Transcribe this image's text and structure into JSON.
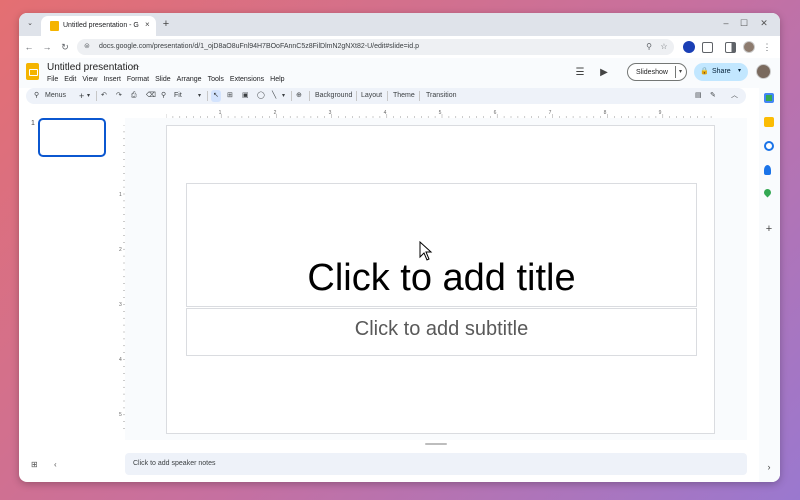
{
  "browser": {
    "tab_title": "Untitled presentation - Google",
    "tab_close": "×",
    "new_tab": "+",
    "tab_list": "⌄",
    "window_minimize": "–",
    "window_maximize": "☐",
    "window_close": "✕",
    "back": "←",
    "forward": "→",
    "reload": "↻",
    "url": "docs.google.com/presentation/d/1_ojD8aO8uFnl94H7BOoFAnnC5z8FilDlmN2gNXt82-U/edit#slide=id.p",
    "site_info": "⊜",
    "zoom_icon": "⚲",
    "bookmark_star": "☆",
    "menu_dots": "⋮"
  },
  "app": {
    "title": "Untitled presentation",
    "star": "☆",
    "menus": [
      "File",
      "Edit",
      "View",
      "Insert",
      "Format",
      "Slide",
      "Arrange",
      "Tools",
      "Extensions",
      "Help"
    ],
    "comments_icon": "☰",
    "meet_icon": "▶",
    "slideshow_label": "Slideshow",
    "slideshow_dropdown": "▾",
    "share_label": "Share",
    "share_lock": "🔒",
    "share_dropdown": "▾"
  },
  "toolbar": {
    "menus_search": "Menus",
    "new_slide": "+",
    "new_slide_dd": "▾",
    "undo": "↶",
    "redo": "↷",
    "print": "⎙",
    "paint_format": "⌫",
    "zoom_icon": "⚲",
    "zoom_value": "Fit",
    "zoom_dd": "▾",
    "select_tool": "↖",
    "textbox_tool": "⊞",
    "image_tool": "▣",
    "shape_tool": "◯",
    "line_tool": "╲",
    "line_dd": "▾",
    "comment_tool": "⊕",
    "background": "Background",
    "layout": "Layout",
    "theme": "Theme",
    "transition": "Transition",
    "chart_icon": "▤",
    "pen_icon": "✎",
    "collapse": "︿"
  },
  "filmstrip": {
    "slide_number": "1"
  },
  "slide": {
    "title_placeholder": "Click to add title",
    "subtitle_placeholder": "Click to add subtitle"
  },
  "ruler": {
    "h_labels": [
      "1",
      "2",
      "3",
      "4",
      "5",
      "6",
      "7",
      "8",
      "9"
    ],
    "v_labels": [
      "1",
      "2",
      "3",
      "4",
      "5"
    ]
  },
  "notes": {
    "placeholder": "Click to add speaker notes"
  },
  "bottom": {
    "grid_icon": "⊞",
    "collapse_left": "‹",
    "expand_right": "›"
  },
  "side_panel": {
    "add": "+"
  },
  "colors": {
    "accent": "#0b57d0",
    "share_bg": "#c2e7ff",
    "slides_yellow": "#f4b400"
  }
}
